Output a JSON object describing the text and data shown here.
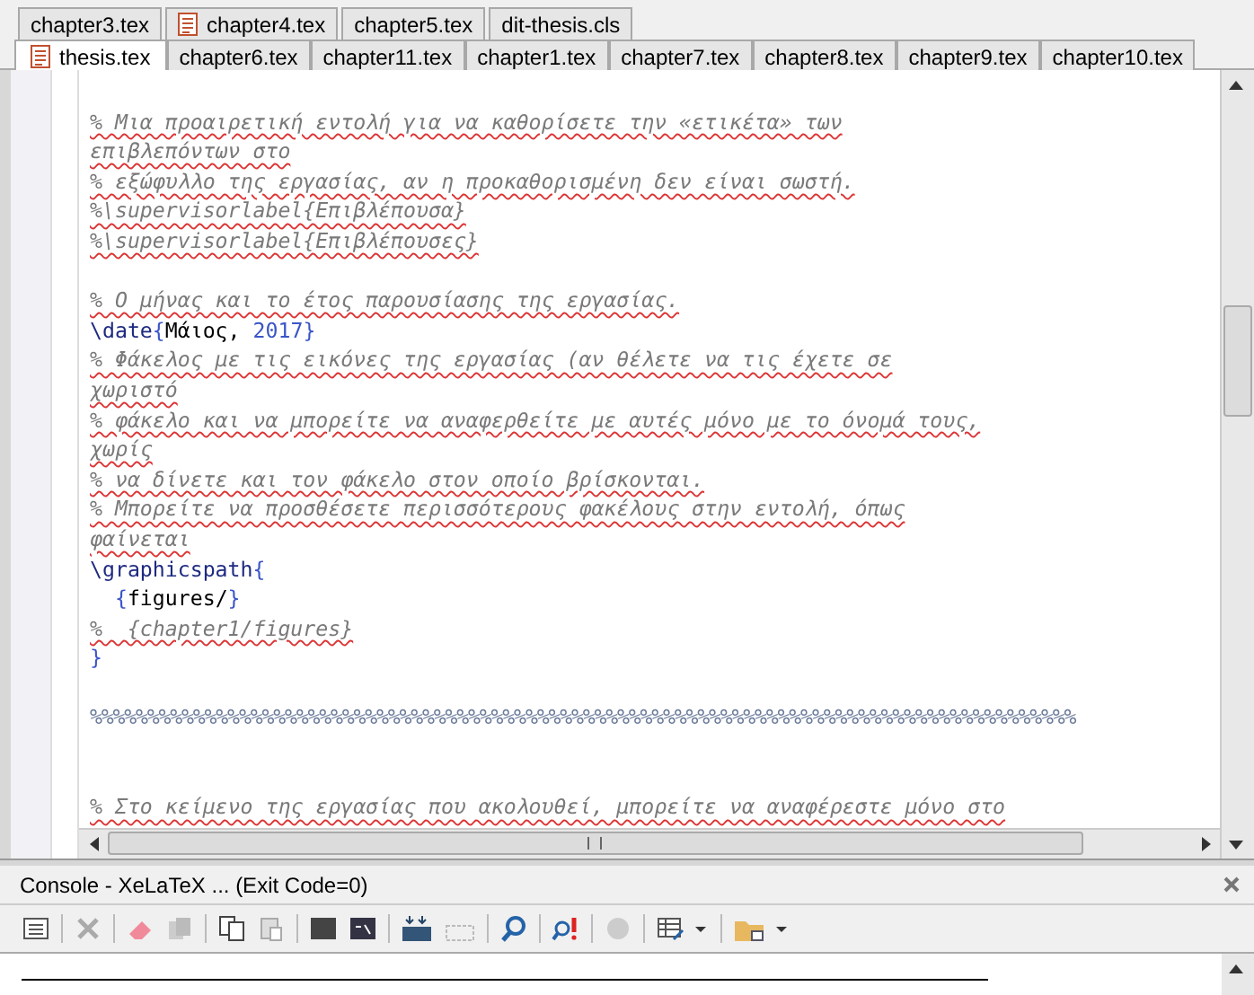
{
  "tab_rows": [
    [
      {
        "label": "chapter3.tex",
        "icon": false,
        "selected": false
      },
      {
        "label": "chapter4.tex",
        "icon": true,
        "selected": false
      },
      {
        "label": "chapter5.tex",
        "icon": false,
        "selected": false
      },
      {
        "label": "dit-thesis.cls",
        "icon": false,
        "selected": false
      }
    ],
    [
      {
        "label": "thesis.tex",
        "icon": true,
        "selected": true
      },
      {
        "label": "chapter6.tex",
        "icon": false,
        "selected": false
      },
      {
        "label": "chapter11.tex",
        "icon": false,
        "selected": false
      },
      {
        "label": "chapter1.tex",
        "icon": false,
        "selected": false
      },
      {
        "label": "chapter7.tex",
        "icon": false,
        "selected": false
      },
      {
        "label": "chapter8.tex",
        "icon": false,
        "selected": false
      },
      {
        "label": "chapter9.tex",
        "icon": false,
        "selected": false
      },
      {
        "label": "chapter10.tex",
        "icon": false,
        "selected": false
      }
    ]
  ],
  "editor": {
    "lines": [
      {
        "kind": "blank"
      },
      {
        "kind": "comment",
        "text": "% Μια προαιρετική εντολή για να καθορίσετε την «ετικέτα» των"
      },
      {
        "kind": "comment",
        "text": "επιβλεπόντων στο"
      },
      {
        "kind": "comment",
        "text": "% εξώφυλλο της εργασίας, αν η προκαθορισμένη δεν είναι σωστή."
      },
      {
        "kind": "comment",
        "text": "%\\supervisorlabel{Επιβλέπουσα}"
      },
      {
        "kind": "comment",
        "text": "%\\supervisorlabel{Επιβλέπουσες}"
      },
      {
        "kind": "blank"
      },
      {
        "kind": "comment",
        "text": "% Ο μήνας και το έτος παρουσίασης της εργασίας."
      },
      {
        "kind": "code",
        "segments": [
          {
            "kind": "command",
            "text": "\\date"
          },
          {
            "kind": "brace",
            "text": "{"
          },
          {
            "kind": "plain",
            "text": "Μάιος, "
          },
          {
            "kind": "number",
            "text": "2017"
          },
          {
            "kind": "brace",
            "text": "}"
          }
        ]
      },
      {
        "kind": "comment",
        "text": "% Φάκελος με τις εικόνες της εργασίας (αν θέλετε να τις έχετε σε"
      },
      {
        "kind": "comment",
        "text": "χωριστό"
      },
      {
        "kind": "comment",
        "text": "% φάκελο και να μπορείτε να αναφερθείτε με αυτές μόνο με το όνομά τους,"
      },
      {
        "kind": "comment",
        "text": "χωρίς"
      },
      {
        "kind": "comment",
        "text": "% να δίνετε και τον φάκελο στον οποίο βρίσκονται."
      },
      {
        "kind": "comment",
        "text": "% Μπορείτε να προσθέσετε περισσότερους φακέλους στην εντολή, όπως"
      },
      {
        "kind": "comment",
        "text": "φαίνεται"
      },
      {
        "kind": "code",
        "segments": [
          {
            "kind": "command",
            "text": "\\graphicspath"
          },
          {
            "kind": "brace",
            "text": "{"
          }
        ]
      },
      {
        "kind": "code",
        "segments": [
          {
            "kind": "brace",
            "text": "  {"
          },
          {
            "kind": "plain",
            "text": "figures/"
          },
          {
            "kind": "brace",
            "text": "}"
          }
        ]
      },
      {
        "kind": "comment",
        "text": "%  {chapter1/figures}"
      },
      {
        "kind": "code",
        "segments": [
          {
            "kind": "brace",
            "text": "}"
          }
        ]
      },
      {
        "kind": "blank"
      },
      {
        "kind": "rule",
        "text": "%%%%%%%%%%%%%%%%%%%%%%%%%%%%%%%%%%%%%%%%%%%%%%%%%%%%%%%%%%%%%%%%%%%%%%%%%%%%%%%%%%%%%%"
      },
      {
        "kind": "blank"
      },
      {
        "kind": "blank"
      },
      {
        "kind": "comment",
        "text": "% Στο κείμενο της εργασίας που ακολουθεί, μπορείτε να αναφέρεστε μόνο στο"
      }
    ]
  },
  "console": {
    "title": "Console - XeLaTeX ... (Exit Code=0)"
  }
}
